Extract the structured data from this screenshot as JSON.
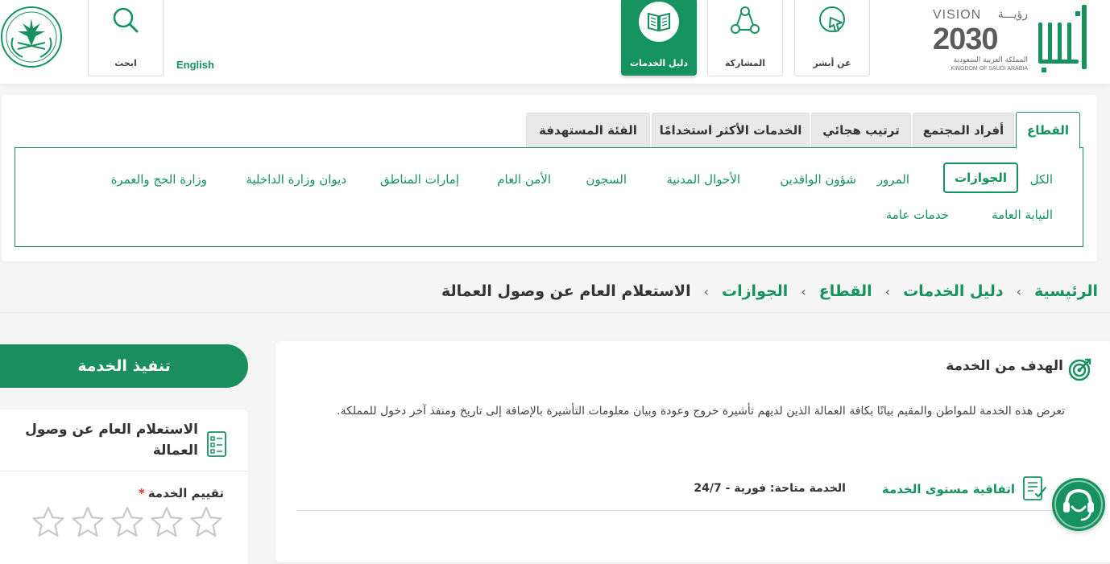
{
  "header": {
    "nav": {
      "about": "عن أبشر",
      "participation": "المشاركة",
      "services_guide": "دليل الخدمات",
      "search": "ابحث"
    },
    "language_link": "English",
    "vision": {
      "word": "VISION",
      "word_ar": "رؤيـــة",
      "number": "2030",
      "kingdom_ar": "المملكة العربية السعودية",
      "kingdom_en": "KINGDOM OF SAUDI ARABIA"
    }
  },
  "filter": {
    "tabs": [
      "القطاع",
      "أفراد المجتمع",
      "ترتيب هجائي",
      "الخدمات الأكثر استخدامًا",
      "الفئة المستهدفة"
    ],
    "active_tab": "القطاع",
    "sectors_row1": [
      "الكل",
      "الجوازات",
      "المرور",
      "شؤون الوافدين",
      "الأحوال المدنية",
      "السجون",
      "الأمن العام",
      "إمارات المناطق",
      "ديوان وزارة الداخلية",
      "وزارة الحج والعمرة"
    ],
    "sectors_row2": [
      "النيابة العامة",
      "خدمات عامة"
    ],
    "active_sector": "الجوازات"
  },
  "breadcrumb": [
    "الرئيسية",
    "دليل الخدمات",
    "القطاع",
    "الجوازات",
    "الاستعلام العام عن وصول العمالة"
  ],
  "service": {
    "goal_title": "الهدف من الخدمة",
    "goal_description": "تعرض هذه الخدمة للمواطن والمقيم بيانًا بكافة العمالة الذين لديهم تأشيرة خروج وعودة وبيان معلومات التأشيرة بالإضافة إلى تاريخ ومنفذ آخر دخول للمملكة.",
    "sla_label": "اتفاقية مستوى الخدمة",
    "availability": "الخدمة متاحة: فورية - 24/7"
  },
  "sidebar": {
    "execute_button": "تنفيذ الخدمة",
    "service_title": "الاستعلام العام عن وصول العمالة",
    "rating_label": "تقييم الخدمة",
    "required_mark": "*",
    "rating_value": 0,
    "rating_max": 5
  },
  "colors": {
    "brand_green": "#16925e",
    "required_red": "#d9342b"
  },
  "icons": {
    "about": "pointer-icon",
    "participation": "share-icon",
    "services_guide": "book-icon",
    "search": "search-icon",
    "goal": "target-icon",
    "sla": "document-check-icon",
    "chat": "support-agent-icon",
    "star": "star-outline-icon"
  }
}
